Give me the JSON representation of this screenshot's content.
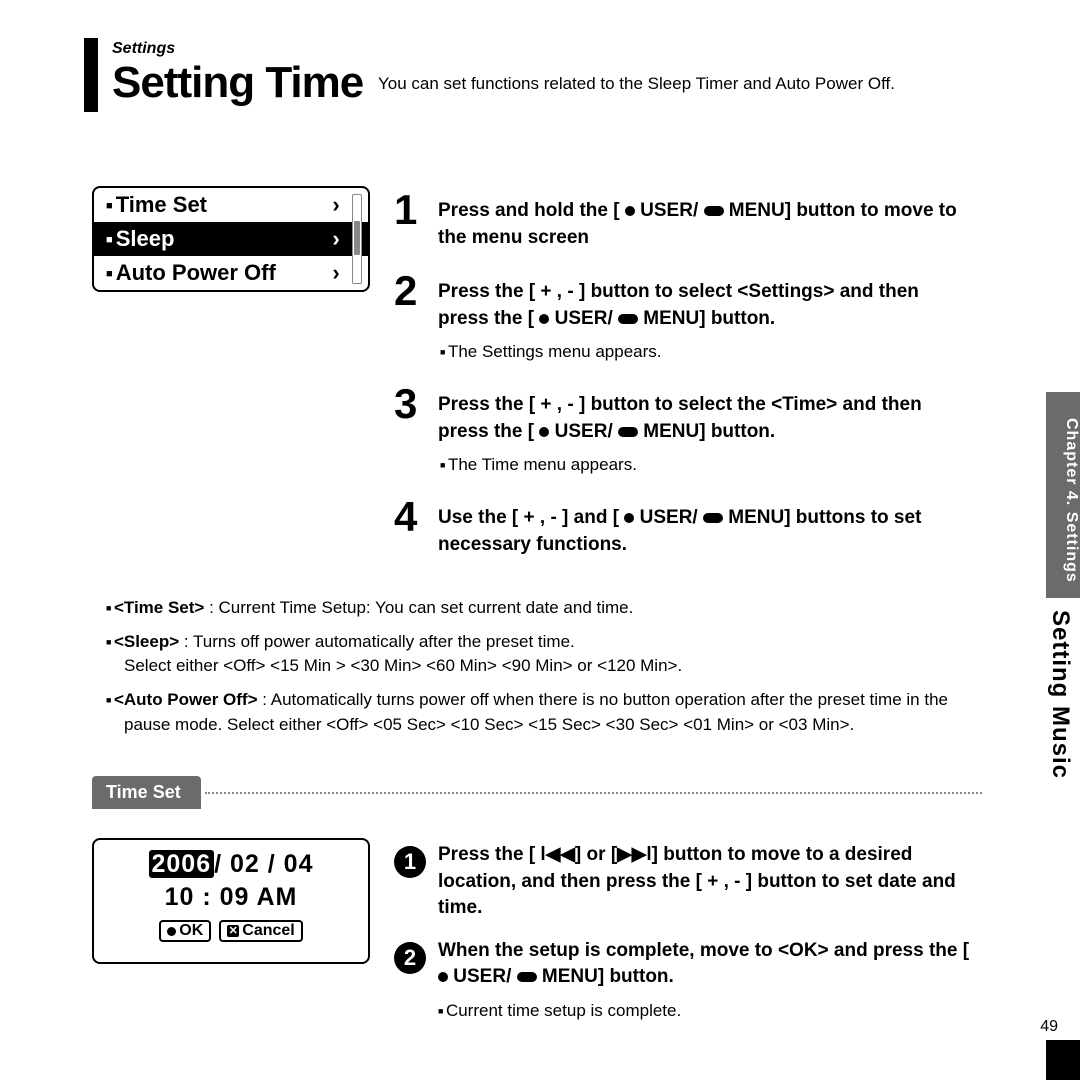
{
  "breadcrumb": "Settings",
  "title": "Setting Time",
  "subtitle": "You can set functions related to the Sleep Timer and Auto Power Off.",
  "menu": {
    "items": [
      "Time Set",
      "Sleep",
      "Auto Power Off"
    ],
    "selected_index": 1
  },
  "steps": [
    {
      "num": "1",
      "text_before": "Press and hold the [",
      "text_after": " MENU] button to move to the menu screen"
    },
    {
      "num": "2",
      "text_before": "Press the [ + , - ] button to select <Settings> and then press the [",
      "text_after": " MENU] button.",
      "sub": "The Settings menu appears."
    },
    {
      "num": "3",
      "text_before": "Press the [ + , - ] button to select the <Time> and then press the [",
      "text_after": " MENU] button.",
      "sub": "The Time menu appears."
    },
    {
      "num": "4",
      "text_before": "Use the [ + , - ] and [",
      "text_after": " MENU] buttons to set necessary functions."
    }
  ],
  "defs": [
    {
      "term": "<Time Set>",
      "desc": " : Current Time Setup: You can set current date and time."
    },
    {
      "term": "<Sleep>",
      "desc": " : Turns off power automatically after the preset time.",
      "desc2": "Select either <Off> <15 Min > <30 Min> <60 Min> <90 Min> or <120 Min>."
    },
    {
      "term": "<Auto Power Off>",
      "desc": " : Automatically turns power off when there is no button operation after the preset time in the pause mode. Select either <Off> <05 Sec> <10 Sec> <15 Sec> <30 Sec> <01 Min> or <03 Min>."
    }
  ],
  "section_header": "Time Set",
  "timeset": {
    "year": "2006",
    "date_rest": "/ 02 / 04",
    "clock": "10 : 09 AM",
    "ok": "OK",
    "cancel": "Cancel"
  },
  "csteps": [
    {
      "num": "1",
      "text": "Press the [ l◀◀] or [▶▶l] button to move to a desired location, and then press the [ + , - ] button to set date and time."
    },
    {
      "num": "2",
      "text_before": "When the setup is complete, move to <OK> and press the [",
      "text_after": " MENU] button.",
      "sub": "Current time setup is complete."
    }
  ],
  "side_tab": "Chapter 4. Settings",
  "side_text": "Setting Music",
  "page_number": "49"
}
